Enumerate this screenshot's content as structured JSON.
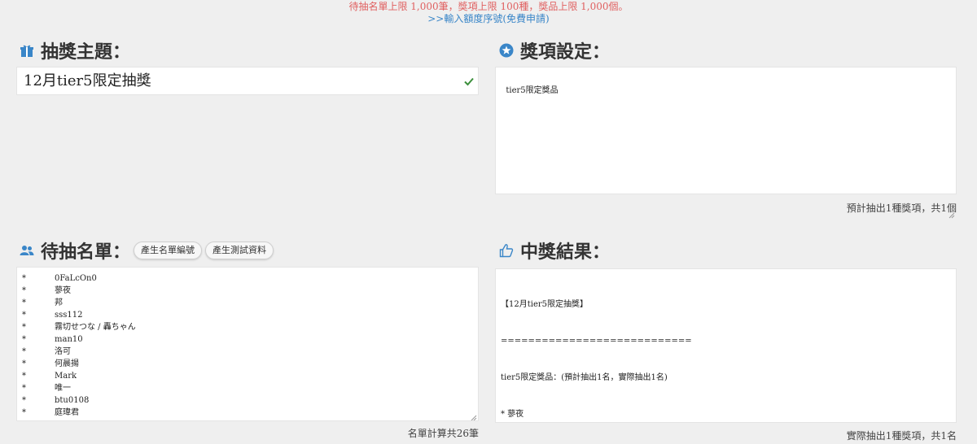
{
  "notice": {
    "limit_text": "待抽名單上限 1,000筆，獎項上限 100種，獎品上限 1,000個。",
    "link_text": ">>輸入額度序號(免費申請)"
  },
  "theme": {
    "heading": "抽獎主題：",
    "value": "12月tier5限定抽獎"
  },
  "prizes": {
    "heading": "獎項設定：",
    "value": "tier5限定獎品",
    "summary": "預計抽出1種獎項，共1個"
  },
  "entrants": {
    "heading": "待抽名單：",
    "btn_generate_ids": "產生名單編號",
    "btn_generate_test": "產生測試資料",
    "summary": "名單計算共26筆",
    "bullet": "*",
    "items": [
      "0FaLcOn0",
      "蓼夜",
      "邦",
      "sss112",
      "霧切せつな / 轟ちゃん",
      "man10",
      "洛可",
      "何晨揚",
      "Mark",
      "唯一",
      "btu0108",
      "庭瑋君"
    ]
  },
  "results": {
    "heading": "中獎結果：",
    "line1": "【12月tier5限定抽獎】",
    "line2": "============================",
    "line3": "tier5限定獎品：(預計抽出1名，實際抽出1名)",
    "line4": "* 蓼夜",
    "summary": "實際抽出1種獎項，共1名"
  },
  "colors": {
    "icon_blue": "#3a86c8",
    "check_green": "#3c8f3c",
    "notice_red": "#e06060"
  },
  "icons": {
    "theme": "gift-icon",
    "prizes": "star-icon",
    "entrants": "users-icon",
    "results": "thumbs-up-icon"
  }
}
